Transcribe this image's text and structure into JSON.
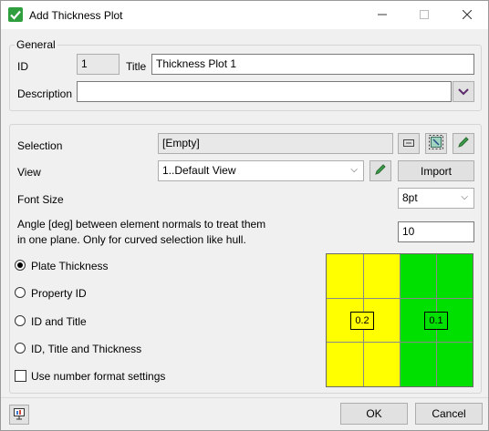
{
  "window": {
    "title": "Add Thickness Plot",
    "title_icon": "check-icon",
    "accent": "#2f9e3f"
  },
  "general": {
    "legend": "General",
    "id_label": "ID",
    "id_value": "1",
    "title_label": "Title",
    "title_value": "Thickness Plot 1",
    "description_label": "Description",
    "description_value": ""
  },
  "settings": {
    "selection_label": "Selection",
    "selection_value": "[Empty]",
    "view_label": "View",
    "view_value": "1..Default View",
    "import_label": "Import",
    "font_size_label": "Font Size",
    "font_size_value": "8pt",
    "angle_label_line1": "Angle [deg] between element normals to treat them",
    "angle_label_line2": "in one plane. Only for curved selection like hull.",
    "angle_value": "10"
  },
  "options": {
    "plate_thickness": "Plate Thickness",
    "property_id": "Property ID",
    "id_and_title": "ID and Title",
    "id_title_thickness": "ID, Title and Thickness",
    "number_format": "Use number format settings",
    "selected": "plate_thickness"
  },
  "preview": {
    "left_value": "0.2",
    "right_value": "0.1",
    "left_color": "#ffff00",
    "right_color": "#00e000"
  },
  "footer": {
    "ok_label": "OK",
    "cancel_label": "Cancel"
  }
}
